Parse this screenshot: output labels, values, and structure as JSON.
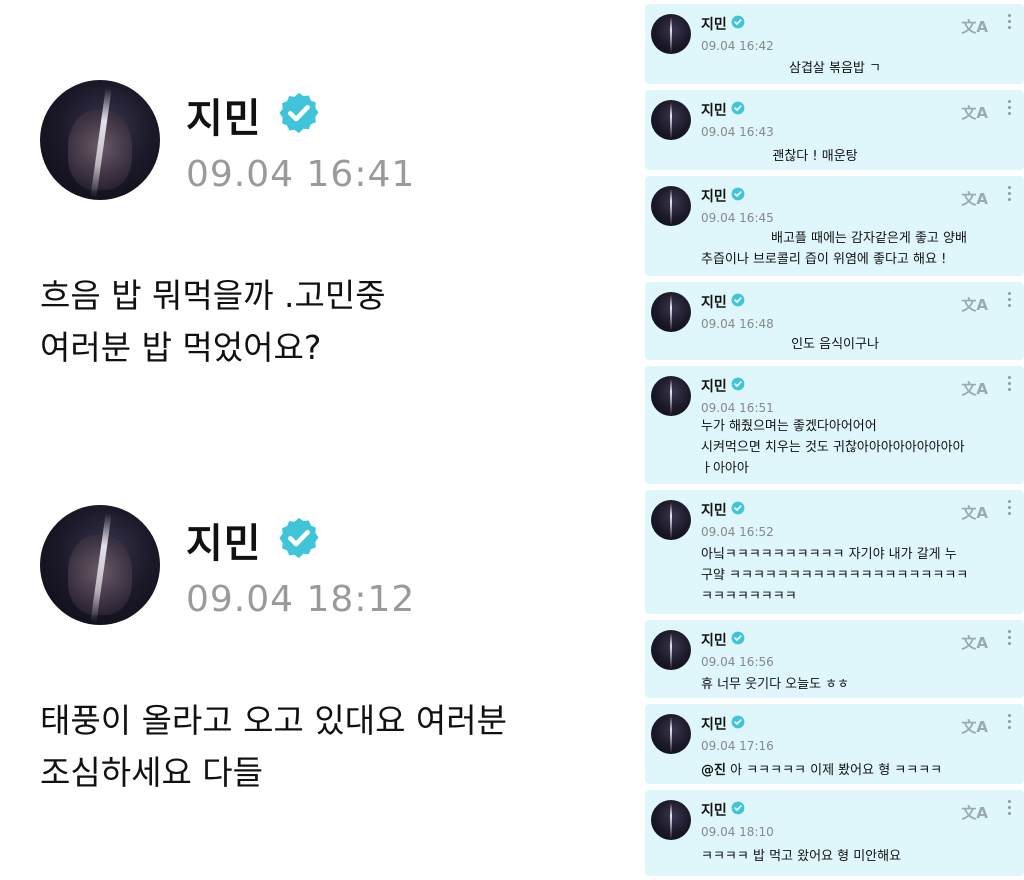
{
  "user": {
    "name": "지민"
  },
  "icons": {
    "verified": "verified-badge-icon",
    "translate": "translate-icon",
    "more": "more-vertical-icon"
  },
  "colors": {
    "verified": "#2fc4d8",
    "card_bg": "#dff7fa"
  },
  "left_posts": [
    {
      "time": "09.04 16:41",
      "lines": [
        "흐음 밥 뭐먹을까 .고민중",
        "여러분 밥 먹었어요?"
      ]
    },
    {
      "time": "09.04 18:12",
      "lines": [
        "태풍이 올라고 오고 있대요 여러분",
        "조심하세요 다들"
      ]
    }
  ],
  "replies": [
    {
      "time": "09.04 16:42",
      "translate": "文A",
      "lines": [
        "삼겹살 볶음밥 ㄱ"
      ]
    },
    {
      "time": "09.04 16:43",
      "translate": "文A",
      "lines": [
        "괜찮다 ! 매운탕"
      ]
    },
    {
      "time": "09.04 16:45",
      "translate": "文A",
      "lines": [
        "배고플 때에는 감자같은게 좋고 양배",
        "추즙이나 브로콜리 즙이 위염에 좋다고 해요 !"
      ]
    },
    {
      "time": "09.04 16:48",
      "translate": "文A",
      "lines": [
        "인도 음식이구나"
      ]
    },
    {
      "time": "09.04 16:51",
      "translate": "文A",
      "lines": [
        "누가 해줬으며는 좋겠다아어어어",
        "시켜먹으면 치우는 것도 귀찮아아아아아아아아아",
        "ㅏ아아아"
      ]
    },
    {
      "time": "09.04 16:52",
      "translate": "文A",
      "lines": [
        "아닠ㅋㅋㅋㅋㅋㅋㅋㅋㅋㅋ 자기야 내가 갈게 누",
        "구얔 ㅋㅋㅋㅋㅋㅋㅋㅋㅋㅋㅋㅋㅋㅋㅋㅋㅋㅋㅋㅋ",
        "ㅋㅋㅋㅋㅋㅋㅋㅋ"
      ]
    },
    {
      "time": "09.04 16:56",
      "translate": "文A",
      "lines": [
        "휴 너무 웃기다 오늘도 ㅎㅎ"
      ]
    },
    {
      "time": "09.04 17:16",
      "translate": "文A",
      "mention": "@진",
      "lines": [
        " 아 ㅋㅋㅋㅋㅋ 이제 봤어요 형 ㅋㅋㅋㅋ"
      ]
    },
    {
      "time": "09.04 18:10",
      "translate": "文A",
      "lines": [
        "ㅋㅋㅋㅋ 밥 먹고 왔어요 형 미안해요"
      ]
    }
  ]
}
